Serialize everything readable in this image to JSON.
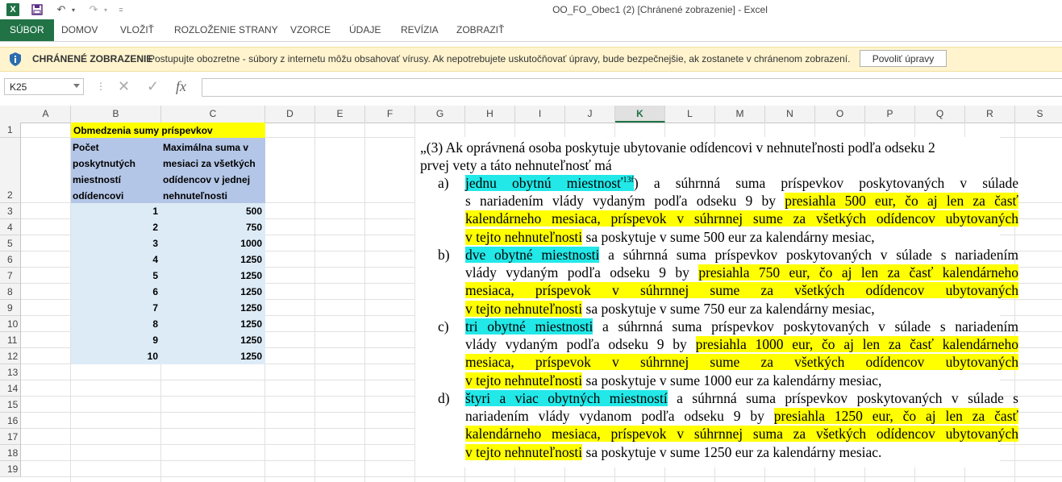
{
  "window": {
    "title": "OO_FO_Obec1 (2)  [Chránené zobrazenie] - Excel"
  },
  "ribbon": {
    "tabs": [
      "SÚBOR",
      "DOMOV",
      "VLOŽIŤ",
      "ROZLOŽENIE STRANY",
      "VZORCE",
      "ÚDAJE",
      "REVÍZIA",
      "ZOBRAZIŤ"
    ]
  },
  "protected_view": {
    "title": "CHRÁNENÉ ZOBRAZENIE",
    "message": "Postupujte obozretne - súbory z internetu môžu obsahovať vírusy. Ak nepotrebujete uskutočňovať úpravy, bude bezpečnejšie, ak zostanete v chránenom zobrazení.",
    "button": "Povoliť úpravy"
  },
  "formula_bar": {
    "name_box": "K25",
    "fx": "fx",
    "content": ""
  },
  "columns": [
    "A",
    "B",
    "C",
    "D",
    "E",
    "F",
    "G",
    "H",
    "I",
    "J",
    "K",
    "L",
    "M",
    "N",
    "O",
    "P",
    "Q",
    "R",
    "S"
  ],
  "selected_column": "K",
  "rows": [
    "1",
    "2",
    "3",
    "4",
    "5",
    "6",
    "7",
    "8",
    "9",
    "10",
    "11",
    "12",
    "13",
    "14",
    "15",
    "16",
    "17",
    "18",
    "19"
  ],
  "table": {
    "title": "Obmedzenia sumy príspevkov",
    "header_b": [
      "Počet",
      "poskytnutých",
      "miestností",
      "odídencovi"
    ],
    "header_c": [
      "Maximálna suma v",
      "mesiaci za všetkých",
      "odídencov v jednej",
      "nehnuteľnosti"
    ],
    "data": [
      {
        "b": "1",
        "c": "500"
      },
      {
        "b": "2",
        "c": "750"
      },
      {
        "b": "3",
        "c": "1000"
      },
      {
        "b": "4",
        "c": "1250"
      },
      {
        "b": "5",
        "c": "1250"
      },
      {
        "b": "6",
        "c": "1250"
      },
      {
        "b": "7",
        "c": "1250"
      },
      {
        "b": "8",
        "c": "1250"
      },
      {
        "b": "9",
        "c": "1250"
      },
      {
        "b": "10",
        "c": "1250"
      }
    ]
  },
  "legal_text": {
    "intro_l1": "„(3) Ak oprávnená osoba poskytuje ubytovanie odídencovi v nehnuteľnosti podľa odseku 2",
    "intro_l2": "prvej vety a táto nehnuteľnosť má",
    "items": [
      {
        "label": "a)",
        "hl": "jednu obytnú miestnosť",
        "sup": "13f",
        "after_hl": ") a súhrnná suma príspevkov poskytovaných v súlade",
        "l2": "s nariadením vlády vydaným podľa odseku 9 by ",
        "y1": "presiahla 500 eur, čo aj len za časť",
        "y2": "kalendárneho mesiaca, príspevok v súhrnnej sume za všetkých odídencov ubytovaných",
        "y3": "v tejto nehnuteľnosti",
        "tail": " sa poskytuje v sume 500 eur za kalendárny mesiac,"
      },
      {
        "label": "b)",
        "hl": "dve obytné miestnosti",
        "after_hl": " a súhrnná suma príspevkov poskytovaných v súlade s nariadením",
        "l2": "vlády vydaným podľa odseku 9 by ",
        "y1": "presiahla 750 eur, čo aj len za časť kalendárneho",
        "y2": "mesiaca, príspevok v súhrnnej sume za všetkých odídencov ubytovaných",
        "y3": "v tejto nehnuteľnosti",
        "tail": " sa poskytuje v sume 750 eur za kalendárny mesiac,"
      },
      {
        "label": "c)",
        "hl": "tri obytné miestnosti",
        "after_hl": " a súhrnná suma príspevkov poskytovaných v súlade s nariadením",
        "l2": "vlády vydaným podľa odseku 9 by ",
        "y1": "presiahla 1000 eur, čo aj len za časť kalendárneho",
        "y2": "mesiaca, príspevok v súhrnnej sume za všetkých odídencov ubytovaných",
        "y3": "v tejto nehnuteľnosti",
        "tail": " sa poskytuje v sume 1000 eur za kalendárny mesiac,"
      },
      {
        "label": "d)",
        "hl": "štyri a viac obytných miestností",
        "after_hl": " a súhrnná suma príspevkov poskytovaných v súlade s",
        "l2": "nariadením vlády vydanom podľa odseku 9 by ",
        "y1": "presiahla 1250 eur, čo aj len za časť",
        "y2": "kalendárneho mesiaca, príspevok v súhrnnej suma za všetkých odídencov ubytovaných",
        "y3": "v tejto nehnuteľnosti",
        "tail": " sa poskytuje v sume 1250 eur za kalendárny mesiac."
      }
    ]
  },
  "colors": {
    "excel_green": "#217346",
    "pv_bg": "#fff4ce",
    "table_title": "#ffff00",
    "table_header": "#b4c6e7",
    "table_body": "#ddebf7",
    "hl_cyan": "#22e8e8",
    "hl_yellow": "#ffff00"
  }
}
